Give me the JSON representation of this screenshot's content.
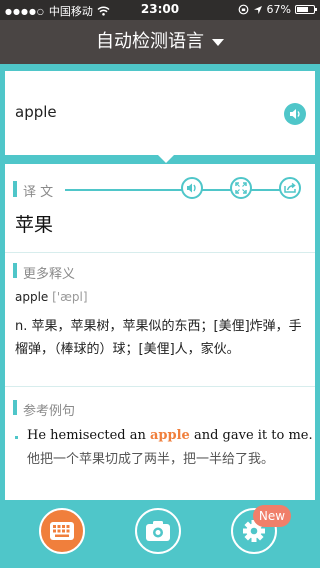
{
  "status": {
    "carrier": "中国移动",
    "time": "23:00",
    "battery": "67%",
    "battery_level": 0.67
  },
  "header": {
    "title": "自动检测语言"
  },
  "input": {
    "text": "apple"
  },
  "translation": {
    "label": "译 文",
    "word": "苹果"
  },
  "more": {
    "label": "更多释义",
    "word": "apple",
    "phonetic": "['æpl]",
    "definition": "n. 苹果，苹果树，苹果似的东西；[美俚]炸弹，手榴弹，（棒球的）球；[美俚]人，家伙。"
  },
  "examples": {
    "label": "参考例句",
    "items": [
      {
        "en_before": "He hemisected an ",
        "en_highlight": "apple",
        "en_after": " and gave it to me.",
        "cn": "他把一个苹果切成了两半，把一半给了我。"
      }
    ]
  },
  "tabs": {
    "badge": "New"
  },
  "colors": {
    "accent": "#4fc6c9",
    "orange": "#f07f3c",
    "header": "#4a4544"
  }
}
